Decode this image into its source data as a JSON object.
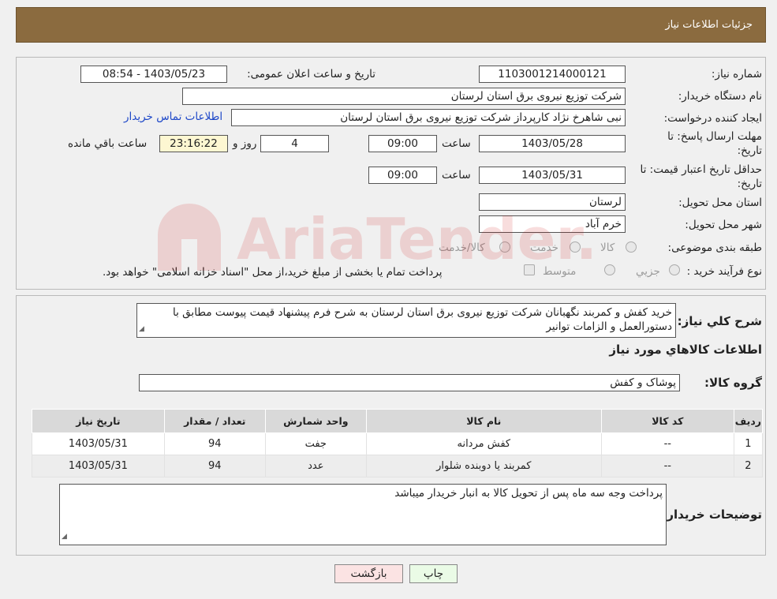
{
  "header": {
    "title": "جزئیات اطلاعات نیاز"
  },
  "fields": {
    "need_number_label": "شماره نیاز:",
    "need_number": "1103001214000121",
    "announce_label": "تاریخ و ساعت اعلان عمومی:",
    "announce_value": "1403/05/23 - 08:54",
    "buyer_org_label": "نام دستگاه خریدار:",
    "buyer_org": "شرکت توزیع نیروی برق استان لرستان",
    "creator_label": "ایجاد کننده درخواست:",
    "creator": "نبی شاهرخ نژاد کارپرداز شرکت توزیع نیروی برق استان لرستان",
    "contact_link": "اطلاعات تماس خریدار",
    "deadline_label_1": "مهلت ارسال پاسخ: تا",
    "deadline_label_2": "تاریخ:",
    "deadline_date": "1403/05/28",
    "time_label": "ساعت",
    "deadline_time": "09:00",
    "days_value": "4",
    "days_label": "روز و",
    "remaining_time": "23:16:22",
    "remaining_label": "ساعت باقي مانده",
    "validity_label_1": "حداقل تاریخ اعتبار قیمت: تا",
    "validity_label_2": "تاریخ:",
    "validity_date": "1403/05/31",
    "validity_time": "09:00",
    "province_label": "استان محل تحویل:",
    "province": "لرستان",
    "city_label": "شهر محل تحویل:",
    "city": "خرم آباد",
    "category_label": "طبقه بندی موضوعی:",
    "category_options": [
      "کالا",
      "خدمت",
      "کالا/خدمت"
    ],
    "process_label": "نوع فرآیند خرید :",
    "process_options": [
      "جزیي",
      "متوسط"
    ],
    "payment_note": "پرداخت تمام یا بخشی از مبلغ خرید،از محل \"اسناد خزانه اسلامی\" خواهد بود."
  },
  "description": {
    "label": "شرح کلي نياز:",
    "text": "خرید کفش و کمربند نگهبانان شرکت توزیع نیروی برق استان لرستان به شرح فرم پیشنهاد قیمت پیوست مطابق با دستورالعمل و الزامات توانیر"
  },
  "goods": {
    "section_title": "اطلاعات کالاهاي مورد نياز",
    "group_label": "گروه کالا:",
    "group_value": "پوشاک و کفش",
    "columns": [
      "ردیف",
      "کد کالا",
      "نام کالا",
      "واحد شمارش",
      "تعداد / مقدار",
      "تاریخ نیاز"
    ],
    "rows": [
      {
        "idx": "1",
        "code": "--",
        "name": "کفش مردانه",
        "unit": "جفت",
        "qty": "94",
        "date": "1403/05/31"
      },
      {
        "idx": "2",
        "code": "--",
        "name": "کمربند یا دوبنده شلوار",
        "unit": "عدد",
        "qty": "94",
        "date": "1403/05/31"
      }
    ]
  },
  "buyer_notes": {
    "label": "توضیحات خریدار:",
    "text": "پرداخت وجه سه ماه پس از تحویل کالا  به انبار خریدار میباشد"
  },
  "buttons": {
    "print": "چاپ",
    "back": "بازگشت"
  },
  "colors": {
    "header": "#8b6b3f",
    "link": "#1d47c8",
    "print_btn": "#eafbe6",
    "back_btn": "#fbe3e3"
  }
}
